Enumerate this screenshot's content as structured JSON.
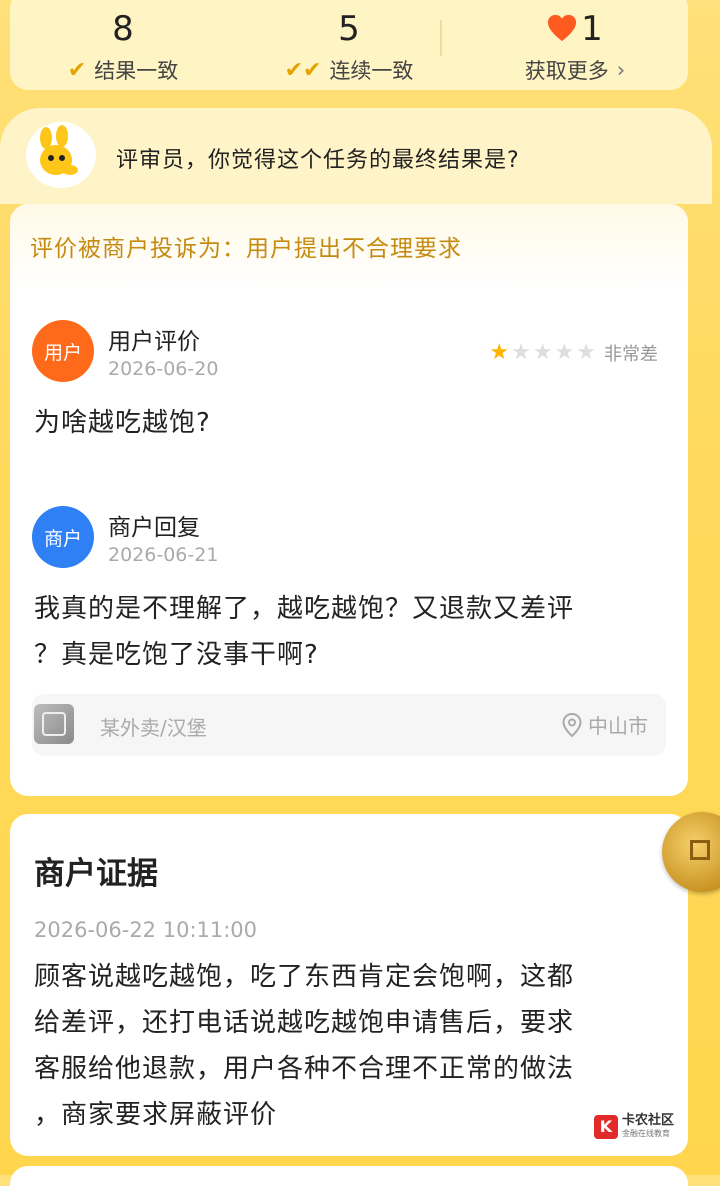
{
  "stats": [
    {
      "value": "8",
      "label": "结果一致",
      "icon": "check-icon"
    },
    {
      "value": "5",
      "label": "连续一致",
      "icon": "double-check-icon"
    },
    {
      "value": "1",
      "label": "获取更多",
      "icon": "heart-icon"
    }
  ],
  "question": {
    "text": "评审员，你觉得这个任务的最终结果是?"
  },
  "complaint": {
    "text": "评价被商户投诉为：用户提出不合理要求"
  },
  "user_review": {
    "badge": "用户",
    "title": "用户评价",
    "date": "2026-06-20",
    "rating": 1,
    "rating_max": 5,
    "rating_text": "非常差",
    "text": "为啥越吃越饱?"
  },
  "merchant_reply": {
    "badge": "商户",
    "title": "商户回复",
    "date": "2026-06-21",
    "text_line1": "我真的是不理解了，越吃越饱？又退款又差评",
    "text_line2": "？真是吃饱了没事干啊?"
  },
  "shop": {
    "name": "某外卖/汉堡",
    "location": "中山市"
  },
  "evidence": {
    "title": "商户证据",
    "datetime": "2026-06-22 10:11:00",
    "text_lines": [
      "顾客说越吃越饱，吃了东西肯定会饱啊，这都",
      "给差评，还打电话说越吃越饱申请售后，要求",
      "客服给他退款，用户各种不合理不正常的做法",
      "，商家要求屏蔽评价"
    ]
  },
  "watermark": {
    "title": "卡农社区",
    "subtitle": "金融在线教育"
  },
  "colors": {
    "accent": "#e2a400",
    "user_badge": "#ff6a1a",
    "merchant_badge": "#2f7ff5",
    "star": "#ffb400"
  }
}
